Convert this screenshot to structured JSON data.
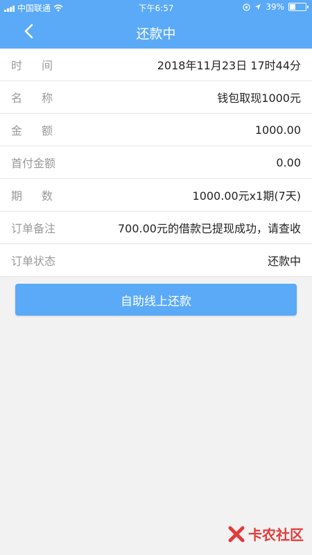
{
  "status_bar": {
    "carrier": "中国联通",
    "time": "下午6:57",
    "battery": "39%",
    "battery_level": 0.39
  },
  "nav": {
    "title": "还款中",
    "back_icon": "chevron-left-icon"
  },
  "rows": [
    {
      "label": "时间",
      "value": "2018年11月23日 17时44分"
    },
    {
      "label": "名称",
      "value": "钱包取现1000元"
    },
    {
      "label": "金额",
      "value": "1000.00"
    },
    {
      "label": "首付金额",
      "value": "0.00"
    },
    {
      "label": "期数",
      "value": "1000.00元x1期(7天)"
    },
    {
      "label": "订单备注",
      "value": "700.00元的借款已提现成功，请查收"
    },
    {
      "label": "订单状态",
      "value": "还款中"
    }
  ],
  "button": {
    "label": "自助线上还款"
  },
  "watermark": {
    "text": "卡农社区"
  },
  "colors": {
    "header": "#5aaaf7",
    "button": "#5aaaf7"
  }
}
